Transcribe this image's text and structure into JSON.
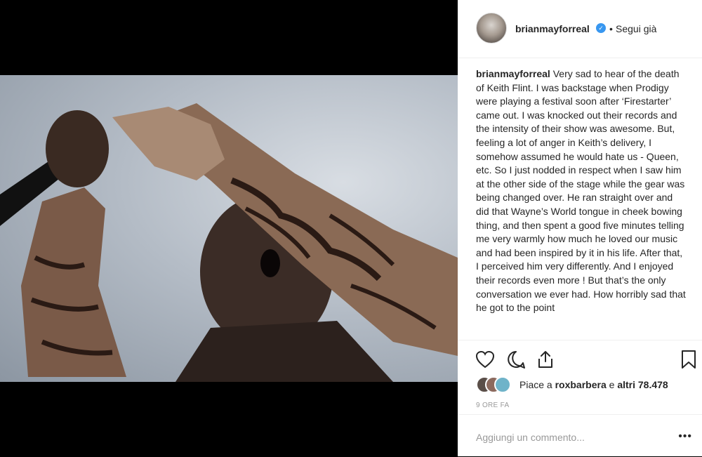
{
  "post": {
    "username": "brianmayforreal",
    "verified_badge": "✓",
    "separator": "•",
    "follow_label": "Segui già",
    "caption_user": "brianmayforreal",
    "caption_text": "Very sad to hear of the death of Keith Flint. I was backstage when Prodigy were playing a festival soon after ‘Firestarter’ came out. I was knocked out their records and the intensity of their show was awesome. But, feeling a lot of anger in Keith’s delivery, I somehow assumed he would hate us - Queen, etc. So I just nodded in respect when I saw him at the other side of the stage while the gear was being changed over. He ran straight over and did that Wayne’s World tongue in cheek bowing thing, and then spent a good five minutes telling me very warmly how much he loved our music and had been inspired by it in his life. After that, I perceived him very differently. And I enjoyed their records even more ! But that’s the only conversation we ever had. How horribly sad that he got to the point",
    "likes_prefix": "Piace a ",
    "likes_user": "roxbarbera",
    "likes_middle": " e ",
    "likes_count": "altri 78.478",
    "timestamp": "9 ORE FA",
    "comment_placeholder": "Aggiungi un commento...",
    "more_icon": "•••"
  },
  "icons": [
    "heart-icon",
    "comment-icon",
    "share-icon",
    "bookmark-icon",
    "more-options-icon",
    "verified-icon"
  ],
  "colors": {
    "accent": "#3897f0",
    "text": "#262626",
    "muted": "#999999",
    "border": "#efefef"
  }
}
